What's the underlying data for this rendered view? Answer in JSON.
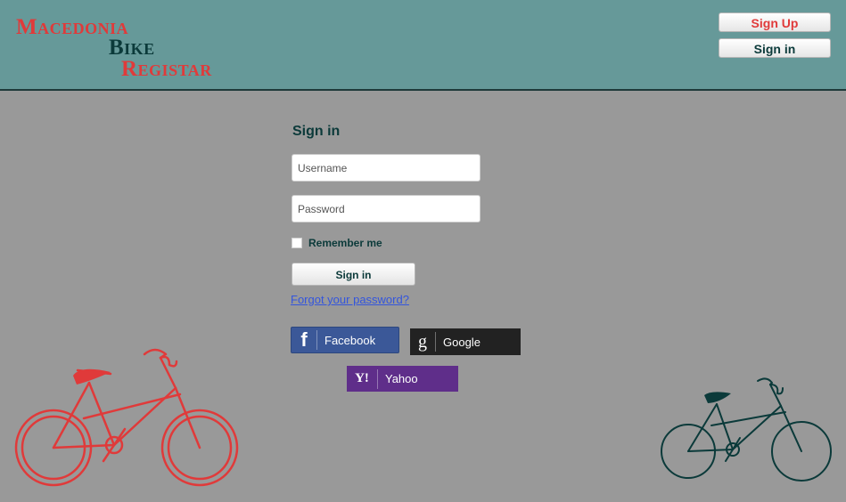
{
  "header": {
    "logo": {
      "line1": "Macedonia",
      "line2": "Bike",
      "line3": "Registar"
    },
    "signup_label": "Sign Up",
    "signin_label": "Sign in"
  },
  "form": {
    "title": "Sign in",
    "username_placeholder": "Username",
    "password_placeholder": "Password",
    "remember_label": "Remember me",
    "submit_label": "Sign in",
    "forgot_label": "Forgot your password?"
  },
  "social": {
    "facebook": "Facebook",
    "google": "Google",
    "yahoo": "Yahoo"
  },
  "colors": {
    "header_bg": "#669999",
    "page_bg": "#999999",
    "accent_red": "#e03a3a",
    "accent_teal": "#0b3a3a",
    "facebook": "#3b5898",
    "google": "#222222",
    "yahoo": "#5f2e8a"
  },
  "icons": [
    "facebook-icon",
    "google-icon",
    "yahoo-icon",
    "red-bicycle-illustration",
    "teal-bicycle-illustration"
  ]
}
